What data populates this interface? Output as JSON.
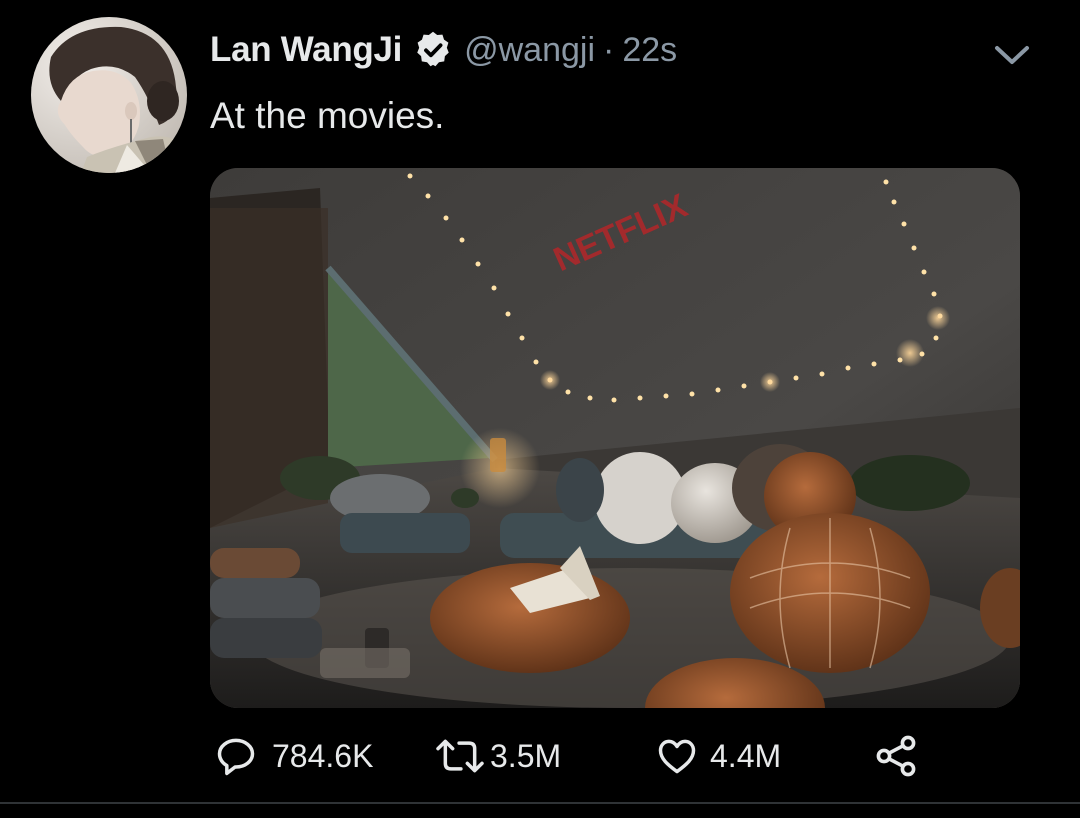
{
  "tweet": {
    "display_name": "Lan WangJi",
    "handle": "@wangji",
    "separator": "·",
    "time": "22s",
    "text": "At the movies.",
    "verified": true,
    "media": {
      "projected_text": "NETFLIX"
    }
  },
  "actions": {
    "reply_count": "784.6K",
    "retweet_count": "3.5M",
    "like_count": "4.4M"
  },
  "icons": {
    "verified": "verified-badge-icon",
    "caret": "chevron-down-icon",
    "reply": "reply-icon",
    "retweet": "retweet-icon",
    "like": "heart-icon",
    "share": "share-icon"
  },
  "colors": {
    "background": "#000000",
    "text": "#e7e9ea",
    "secondary": "#8b98a5",
    "netflix_red": "#b3262a"
  }
}
